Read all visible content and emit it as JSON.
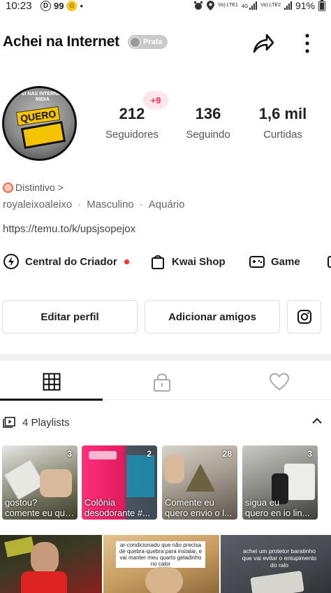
{
  "status_bar": {
    "time": "10:23",
    "left_icons": [
      "D",
      "99",
      "☺",
      "•"
    ],
    "battery": "91%",
    "net1": "Vo) LTE1",
    "net2": "4G",
    "net3": "Vo) LTE2"
  },
  "header": {
    "title": "Achei na  Internet",
    "badge_label": "Prata"
  },
  "profile": {
    "avatar_text_top": "EI NAS INTERNET MIDIA",
    "avatar_text_main": "QUERO"
  },
  "stats": {
    "followers_count": "212",
    "followers_label": "Seguidores",
    "followers_new": "+9",
    "following_count": "136",
    "following_label": "Seguindo",
    "likes_count": "1,6 mil",
    "likes_label": "Curtidas"
  },
  "bio": {
    "distintivo": "Distintivo >",
    "username": "royaleixoaleixo",
    "gender": "Masculino",
    "sign": "Aquário",
    "link": "https://temu.to/k/upsjsopejox"
  },
  "quick_links": {
    "creator": "Central do Criador",
    "shop": "Kwai Shop",
    "game": "Game"
  },
  "buttons": {
    "edit": "Editar perfil",
    "add_friends": "Adicionar amigos"
  },
  "playlists": {
    "header": "4 Playlists",
    "items": [
      {
        "count": "3",
        "line1": "gostou?",
        "line2": "comente eu que..."
      },
      {
        "count": "2",
        "line1": "Colônia",
        "line2": "desodorante #..."
      },
      {
        "count": "28",
        "line1": "Comente eu",
        "line2": "quero envio o l..."
      },
      {
        "count": "3",
        "line1": "sigua eu",
        "line2": "quero en io lin..."
      }
    ]
  },
  "thumbs": {
    "t2_caption": "ar-condicionado que não precisa de quebra-quebra para instalar, e vai manter meu quarto geladinho no calor",
    "t3_caption": "achei um protetor baratinho que vai evitar o entupimento do ralo"
  },
  "colors": {
    "accent": "#ff2d55",
    "red_dot": "#ff2d2d",
    "text": "#222222",
    "muted": "#555555"
  }
}
